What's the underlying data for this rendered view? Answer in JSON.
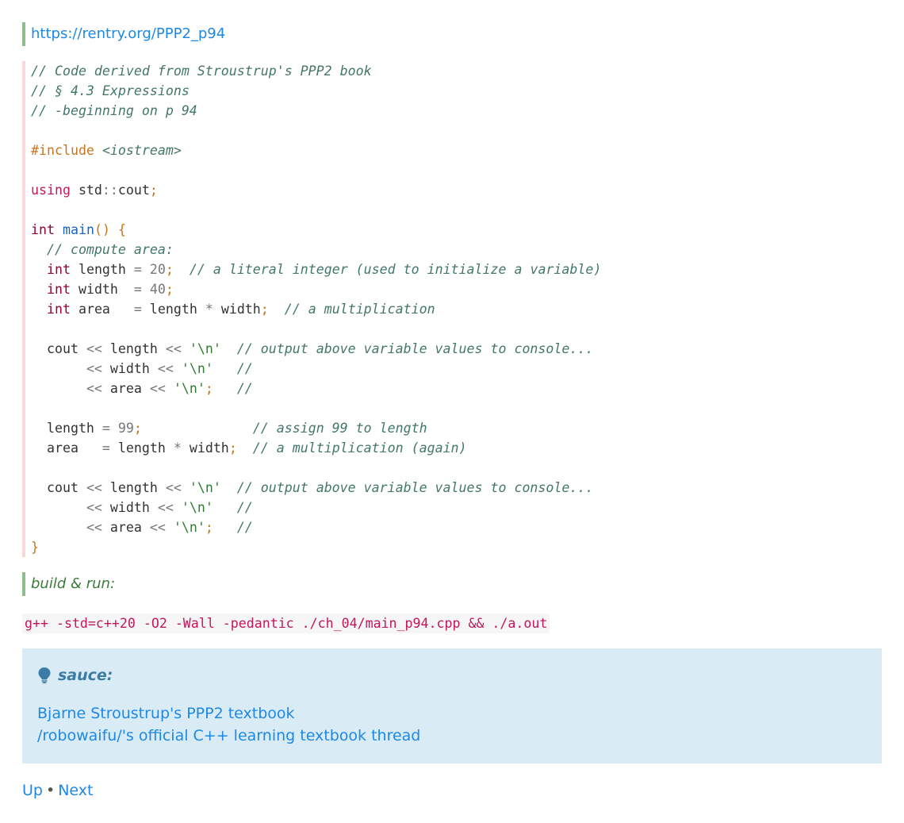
{
  "header_link": "https://rentry.org/PPP2_p94",
  "code_lines": [
    "// Code derived from Stroustrup's PPP2 book",
    "// § 4.3 Expressions",
    "// -beginning on p 94",
    "",
    "#include <iostream>",
    "",
    "using std::cout;",
    "",
    "int main() {",
    "  // compute area:",
    "  int length = 20;  // a literal integer (used to initialize a variable)",
    "  int width  = 40;",
    "  int area   = length * width;  // a multiplication",
    "",
    "  cout << length << '\\n'  // output above variable values to console...",
    "       << width << '\\n'   //",
    "       << area << '\\n';   //",
    "",
    "  length = 99;              // assign 99 to length",
    "  area   = length * width;  // a multiplication (again)",
    "",
    "  cout << length << '\\n'  // output above variable values to console...",
    "       << width << '\\n'   //",
    "       << area << '\\n';   //",
    "}"
  ],
  "build_label": "build & run:",
  "build_command": "g++ -std=c++20 -O2 -Wall -pedantic ./ch_04/main_p94.cpp && ./a.out",
  "sauce": {
    "title": "sauce:",
    "icon": "lightbulb-icon",
    "links": [
      "Bjarne Stroustrup's PPP2 textbook",
      "/robowaifu/'s official C++ learning textbook thread"
    ]
  },
  "nav": {
    "up": "Up",
    "separator": "•",
    "next": "Next"
  },
  "colors": {
    "link": "#1e88e5",
    "admonition_bg": "#d9ecf5",
    "quote_border": "#8fbc8f",
    "code_border": "#f7d9dc"
  }
}
